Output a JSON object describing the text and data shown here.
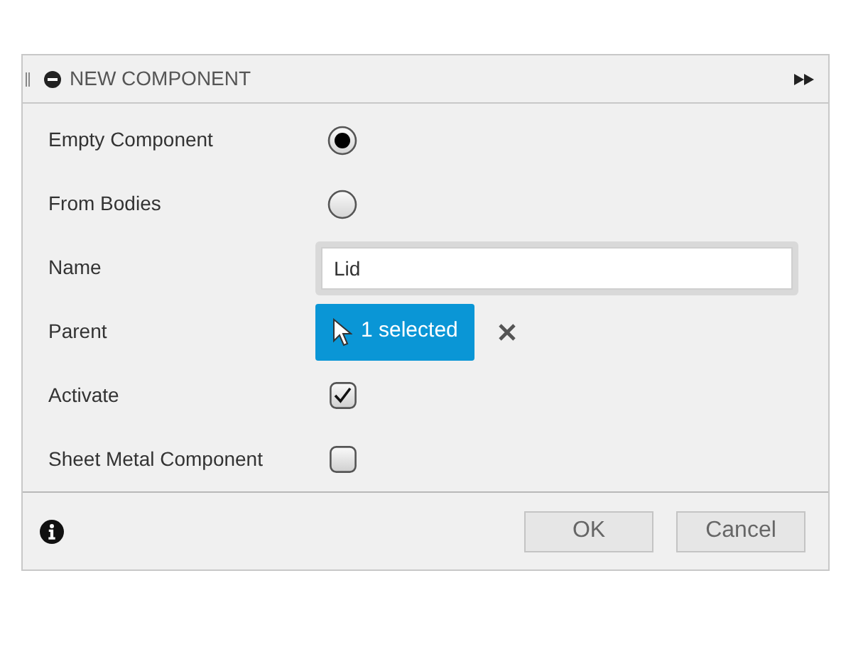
{
  "dialog": {
    "title": "NEW COMPONENT",
    "expanded": true
  },
  "rows": [
    {
      "kind": "radio",
      "label": "Empty Component",
      "selected": true
    },
    {
      "kind": "radio",
      "label": "From Bodies",
      "selected": false
    },
    {
      "kind": "text",
      "label": "Name",
      "value": "Lid"
    },
    {
      "kind": "selection",
      "label": "Parent",
      "value": "1 selected"
    },
    {
      "kind": "checkbox",
      "label": "Activate",
      "checked": true
    },
    {
      "kind": "checkbox",
      "label": "Sheet Metal Component",
      "checked": false
    }
  ],
  "buttons": [
    "OK",
    "Cancel"
  ]
}
